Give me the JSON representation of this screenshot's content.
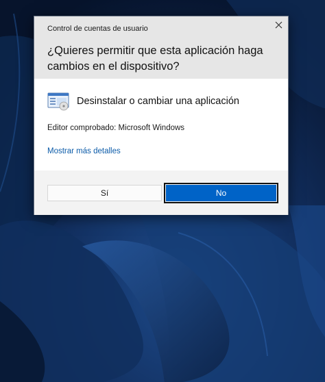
{
  "dialog": {
    "title": "Control de cuentas de usuario",
    "close_glyph": "✕",
    "question": "¿Quieres permitir que esta aplicación haga cambios en el dispositivo?",
    "app_name": "Desinstalar o cambiar una aplicación",
    "app_icon": "programs-features-icon",
    "publisher": "Editor comprobado: Microsoft Windows",
    "details_link": "Mostrar más detalles",
    "yes_label": "Sí",
    "no_label": "No"
  },
  "colors": {
    "accent": "#0063c7",
    "link": "#0a5aa8",
    "header_bg": "#e6e6e6",
    "footer_bg": "#f3f3f3",
    "desktop_bg": "#0b1d3d"
  },
  "desktop": {
    "wallpaper": "windows-11-bloom-dark"
  }
}
